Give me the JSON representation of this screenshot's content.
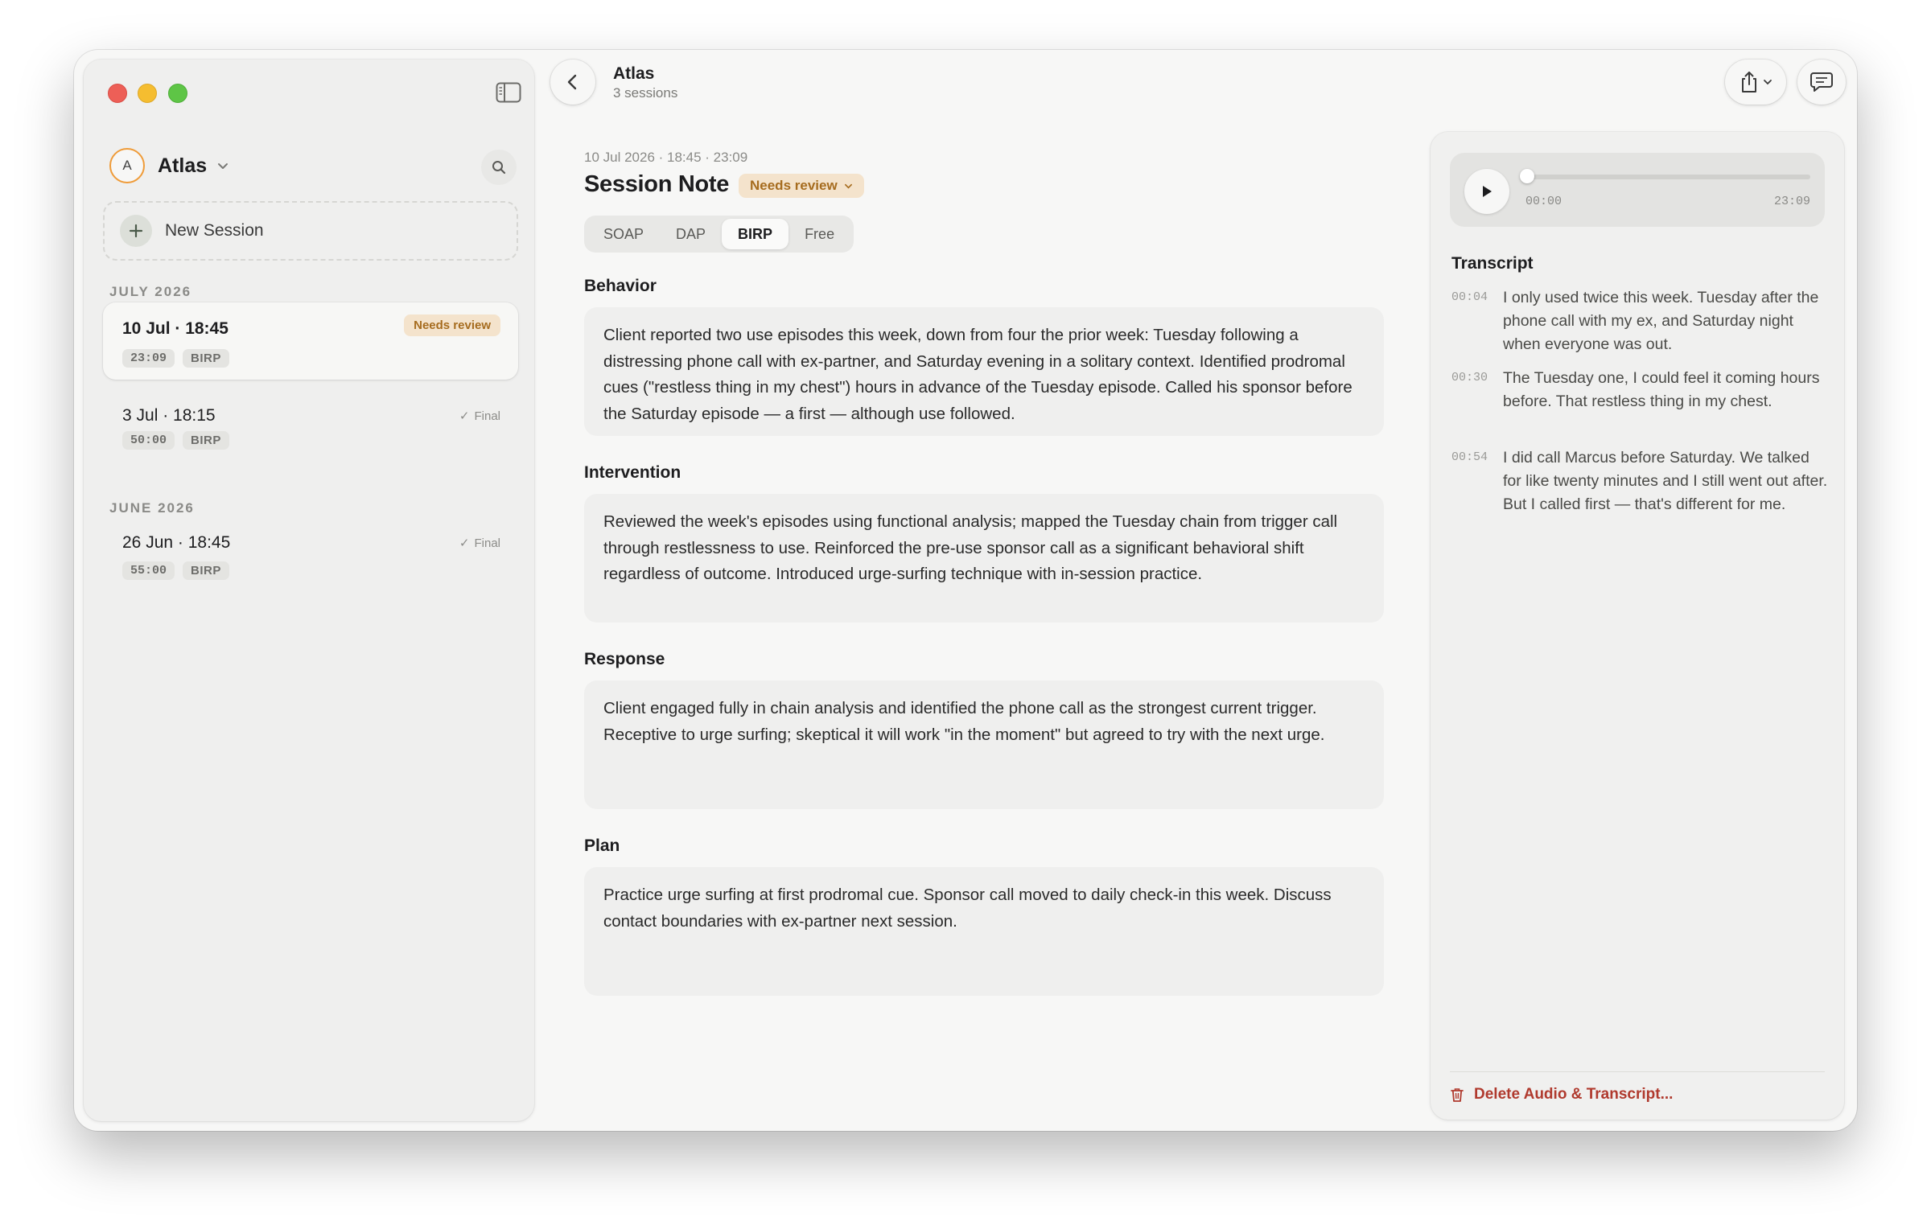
{
  "sidebar": {
    "workspace": {
      "initial": "A",
      "name": "Atlas"
    },
    "new_session_label": "New Session",
    "groups": [
      {
        "month": "JULY 2026",
        "sessions": [
          {
            "title": "10 Jul · 18:45",
            "duration": "23:09",
            "format": "BIRP",
            "status": "Needs review"
          },
          {
            "title": "3 Jul · 18:15",
            "duration": "50:00",
            "format": "BIRP",
            "status": "Final"
          }
        ]
      },
      {
        "month": "JUNE 2026",
        "sessions": [
          {
            "title": "26 Jun · 18:45",
            "duration": "55:00",
            "format": "BIRP",
            "status": "Final"
          }
        ]
      }
    ]
  },
  "header": {
    "title": "Atlas",
    "subtitle": "3 sessions"
  },
  "note": {
    "meta": "10 Jul 2026 · 18:45 · 23:09",
    "title": "Session Note",
    "status": "Needs review",
    "tabs": [
      "SOAP",
      "DAP",
      "BIRP",
      "Free"
    ],
    "active_tab": "BIRP",
    "sections": [
      {
        "label": "Behavior",
        "text": "Client reported two use episodes this week, down from four the prior week: Tuesday following a distressing phone call with ex-partner, and Saturday evening in a solitary context. Identified prodromal cues (\"restless thing in my chest\") hours in advance of the Tuesday episode. Called his sponsor before the Saturday episode — a first — although use followed."
      },
      {
        "label": "Intervention",
        "text": "Reviewed the week's episodes using functional analysis; mapped the Tuesday chain from trigger call through restlessness to use. Reinforced the pre-use sponsor call as a significant behavioral shift regardless of outcome. Introduced urge-surfing technique with in-session practice."
      },
      {
        "label": "Response",
        "text": "Client engaged fully in chain analysis and identified the phone call as the strongest current trigger. Receptive to urge surfing; skeptical it will work \"in the moment\" but agreed to try with the next urge."
      },
      {
        "label": "Plan",
        "text": "Practice urge surfing at first prodromal cue. Sponsor call moved to daily check-in this week. Discuss contact boundaries with ex-partner next session."
      }
    ]
  },
  "player": {
    "current": "00:00",
    "total": "23:09",
    "progress": 0
  },
  "transcript": {
    "title": "Transcript",
    "entries": [
      {
        "time": "00:04",
        "text": "I only used twice this week. Tuesday after the phone call with my ex, and Saturday night when everyone was out."
      },
      {
        "time": "00:30",
        "text": "The Tuesday one, I could feel it coming hours before. That restless thing in my chest."
      },
      {
        "time": "00:54",
        "text": "I did call Marcus before Saturday. We talked for like twenty minutes and I still went out after. But I called first — that's different for me."
      }
    ]
  },
  "delete_label": "Delete Audio & Transcript...",
  "colors": {
    "accent_orange": "#ef9b38",
    "review_badge_bg": "#f4e3cc",
    "review_badge_text": "#a66c1f",
    "danger": "#b03a2e"
  },
  "icons": [
    "sidebar-toggle-icon",
    "chevron-down-icon",
    "search-icon",
    "plus-icon",
    "checkmark-icon",
    "chevron-left-icon",
    "share-icon",
    "comment-icon",
    "play-icon",
    "trash-icon"
  ]
}
